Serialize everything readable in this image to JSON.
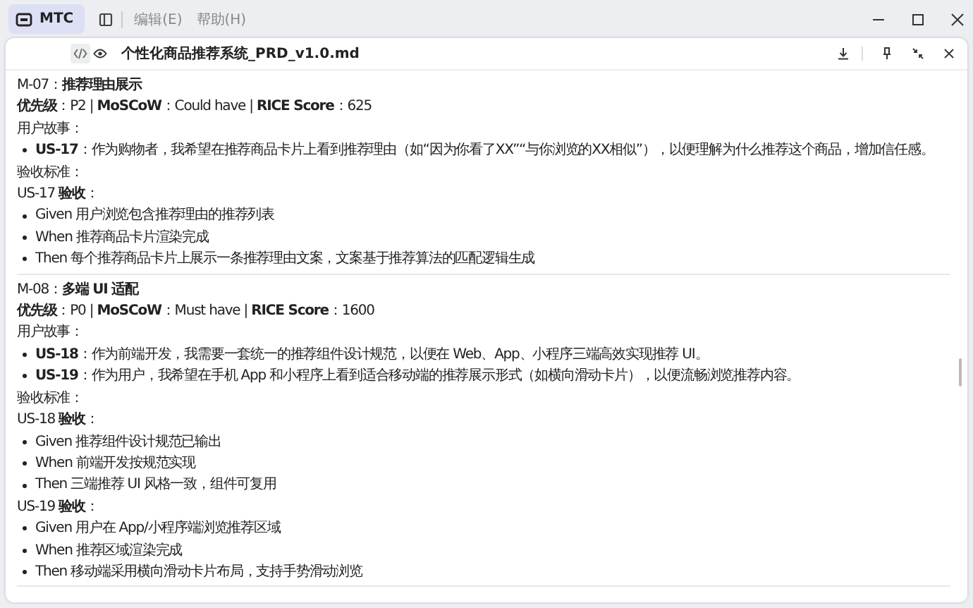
{
  "app": {
    "name": "MTC",
    "menu": [
      "编辑(E)",
      "帮助(H)"
    ]
  },
  "document": {
    "title": "个性化商品推荐系统_PRD_v1.0.md",
    "modes": [
      {
        "kind": "code",
        "selected": true
      },
      {
        "kind": "preview",
        "selected": false
      }
    ]
  },
  "sections": [
    {
      "heading": "M-07：**推荐理由展示**",
      "priority": "**优先级**：P2 | **MoSCoW**：Could have | **RICE Score**：625",
      "stories_label": "用户故事：",
      "stories": [
        "**US-17**：作为购物者，我希望在推荐商品卡片上看到推荐理由（如“因为你看了XX”“与你浏览的XX相似”），以便理解为什么推荐这个商品，增加信任感。"
      ],
      "acceptance_label": "验收标准：",
      "groups": [
        {
          "title": "US-17 **验收**：",
          "items": [
            "Given 用户浏览包含推荐理由的推荐列表",
            "When 推荐商品卡片渲染完成",
            "Then 每个推荐商品卡片上展示一条推荐理由文案，文案基于推荐算法的匹配逻辑生成"
          ]
        }
      ]
    },
    {
      "heading": "M-08：**多端 UI 适配**",
      "priority": "**优先级**：P0 | **MoSCoW**：Must have | **RICE Score**：1600",
      "stories_label": "用户故事：",
      "stories": [
        "**US-18**：作为前端开发，我需要一套统一的推荐组件设计规范，以便在 Web、App、小程序三端高效实现推荐 UI。",
        "**US-19**：作为用户，我希望在手机 App 和小程序上看到适合移动端的推荐展示形式（如横向滑动卡片），以便流畅浏览推荐内容。"
      ],
      "acceptance_label": "验收标准：",
      "groups": [
        {
          "title": "US-18 **验收**：",
          "items": [
            "Given 推荐组件设计规范已输出",
            "When 前端开发按规范实现",
            "Then 三端推荐 UI 风格一致，组件可复用"
          ]
        },
        {
          "title": "US-19 **验收**：",
          "items": [
            "Given 用户在 App/小程序端浏览推荐区域",
            "When 推荐区域渲染完成",
            "Then 移动端采用横向滑动卡片布局，支持手势滑动浏览"
          ]
        }
      ]
    }
  ]
}
